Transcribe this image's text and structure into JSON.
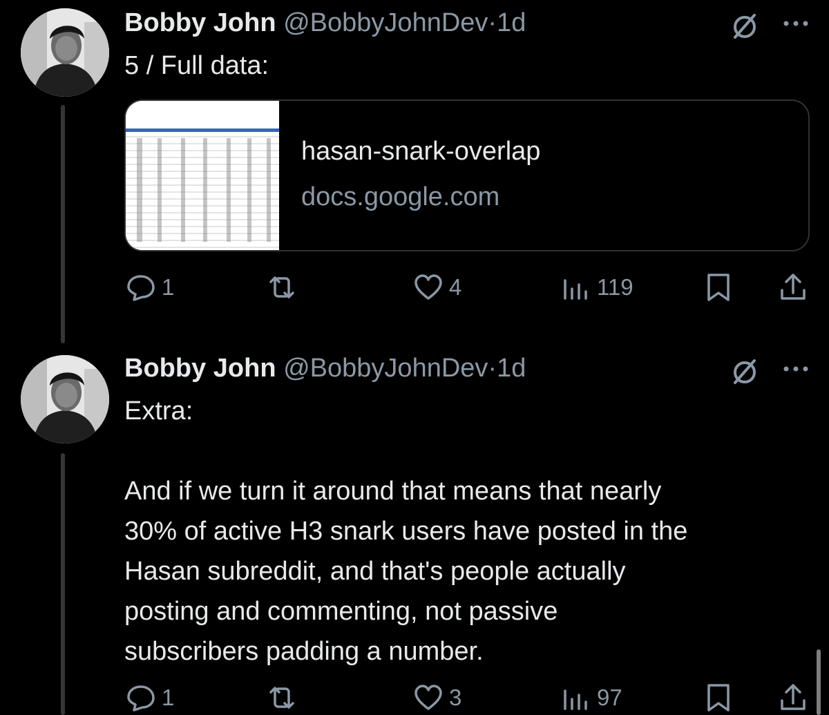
{
  "tweets": [
    {
      "author_name": "Bobby John",
      "handle": "@BobbyJohnDev",
      "separator": "·",
      "time": "1d",
      "text_lines": [
        "5 / Full data:"
      ],
      "card": {
        "title": "hasan-snark-overlap",
        "domain": "docs.google.com"
      },
      "replies": "1",
      "retweets": "",
      "likes": "4",
      "views": "119"
    },
    {
      "author_name": "Bobby John",
      "handle": "@BobbyJohnDev",
      "separator": "·",
      "time": "1d",
      "text_lines": [
        "Extra:",
        "",
        "And if we turn it around that means that nearly",
        "30% of active H3 snark users have posted in the",
        "Hasan subreddit, and that's people actually",
        "posting and commenting, not passive",
        "subscribers padding a number."
      ],
      "replies": "1",
      "retweets": "",
      "likes": "3",
      "views": "97"
    }
  ],
  "icons": {
    "reply": "reply-icon",
    "retweet": "retweet-icon",
    "like": "heart-icon",
    "views": "views-icon",
    "bookmark": "bookmark-icon",
    "share": "share-icon",
    "grok": "grok-icon",
    "more": "more-icon"
  },
  "colors": {
    "background": "#000000",
    "text": "#e7e9ea",
    "secondary": "#8b98a5",
    "border": "#2f3336"
  }
}
